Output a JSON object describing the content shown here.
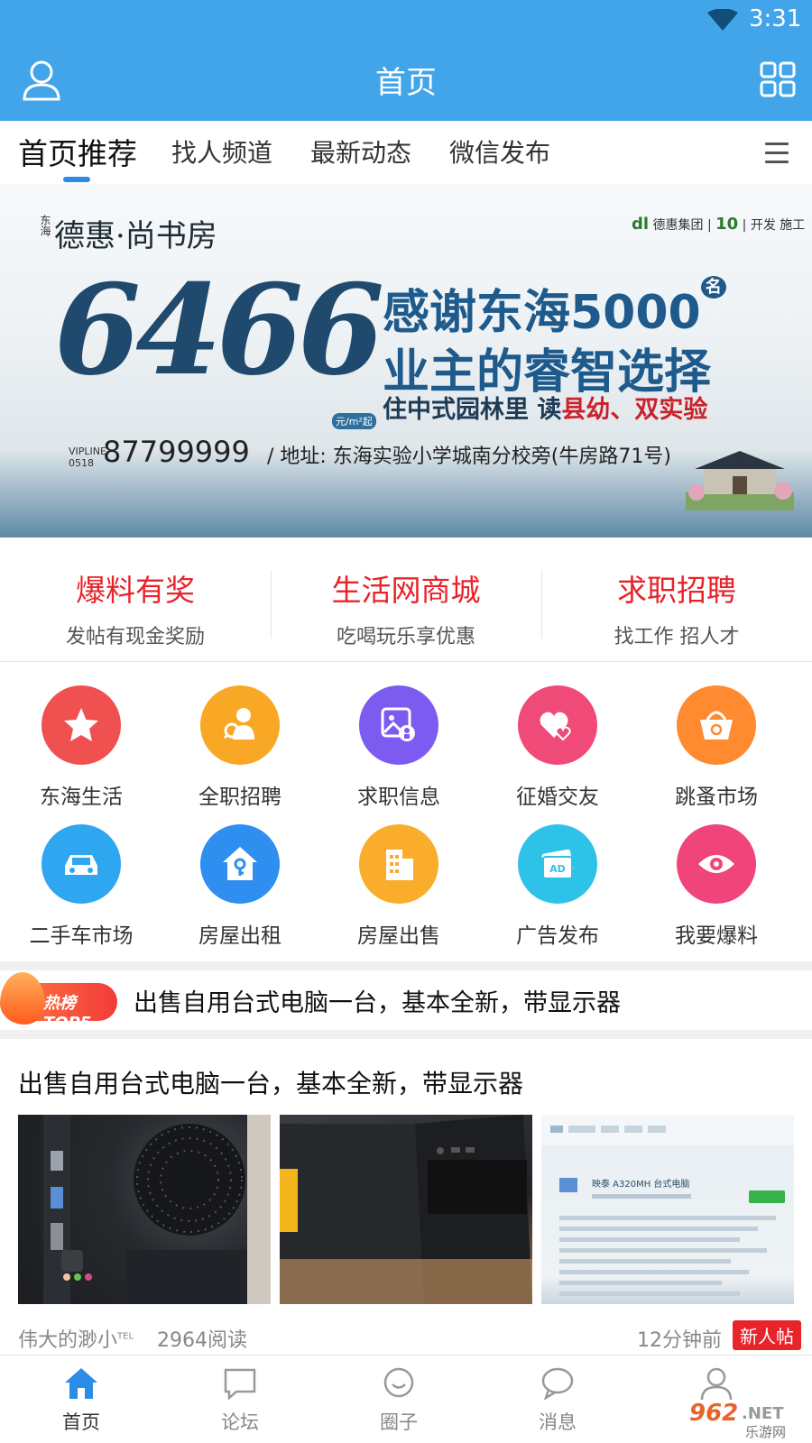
{
  "status": {
    "time": "3:31"
  },
  "header": {
    "title": "首页"
  },
  "tabs": [
    {
      "label": "首页推荐"
    },
    {
      "label": "找人频道"
    },
    {
      "label": "最新动态"
    },
    {
      "label": "微信发布"
    }
  ],
  "banner": {
    "brand": "德惠·尚书房",
    "brand_prefix": "东海",
    "corp": "德惠集团",
    "corp_note": "开发 施工",
    "price": "6466",
    "price_unit": "元/m²起",
    "headline1": "感谢东海5000",
    "headline1_suffix": "名",
    "headline2": "业主的睿智选择",
    "sub_a": "住中式园林里 读",
    "sub_b": "县幼、双实验",
    "vip": "VIPLINE",
    "area_code": "0518",
    "phone": "87799999",
    "address": "/ 地址: 东海实验小学城南分校旁(牛房路71号)"
  },
  "promo": [
    {
      "title": "爆料有奖",
      "subtitle": "发帖有现金奖励"
    },
    {
      "title": "生活网商城",
      "subtitle": "吃喝玩乐享优惠"
    },
    {
      "title": "求职招聘",
      "subtitle": "找工作 招人才"
    }
  ],
  "grid": [
    {
      "label": "东海生活",
      "icon": "star-icon",
      "color": "#f0504f"
    },
    {
      "label": "全职招聘",
      "icon": "recruit-icon",
      "color": "#f9a825"
    },
    {
      "label": "求职信息",
      "icon": "resume-icon",
      "color": "#7c5cf0"
    },
    {
      "label": "征婚交友",
      "icon": "hearts-icon",
      "color": "#f04a78"
    },
    {
      "label": "跳蚤市场",
      "icon": "basket-icon",
      "color": "#ff8a30"
    },
    {
      "label": "二手车市场",
      "icon": "car-icon",
      "color": "#2fa6f0"
    },
    {
      "label": "房屋出租",
      "icon": "house-key-icon",
      "color": "#2e8ff0"
    },
    {
      "label": "房屋出售",
      "icon": "building-icon",
      "color": "#f9ad2a"
    },
    {
      "label": "广告发布",
      "icon": "ad-icon",
      "color": "#2ec2e8"
    },
    {
      "label": "我要爆料",
      "icon": "eye-icon",
      "color": "#f0457a"
    }
  ],
  "hot": {
    "badge": "热榜TOP5",
    "title": "出售自用台式电脑一台，基本全新，带显示器"
  },
  "post": {
    "title": "出售自用台式电脑一台，基本全新，带显示器",
    "author": "伟大的渺小",
    "reads": "2964阅读",
    "time": "12分钟前",
    "badge": "新人帖",
    "screen_title": "映泰 A320MH 台式电脑"
  },
  "bottomnav": [
    {
      "label": "首页",
      "icon": "home-icon",
      "active": true
    },
    {
      "label": "论坛",
      "icon": "forum-icon"
    },
    {
      "label": "圈子",
      "icon": "circle-chat-icon"
    },
    {
      "label": "消息",
      "icon": "message-icon"
    },
    {
      "label": "",
      "icon": "profile-icon"
    }
  ],
  "watermark": {
    "text": "962.NET",
    "sub": "乐游网"
  },
  "colors": {
    "primary": "#42a5ea",
    "accent_red": "#e8232a",
    "indicator": "#2c8de6"
  }
}
